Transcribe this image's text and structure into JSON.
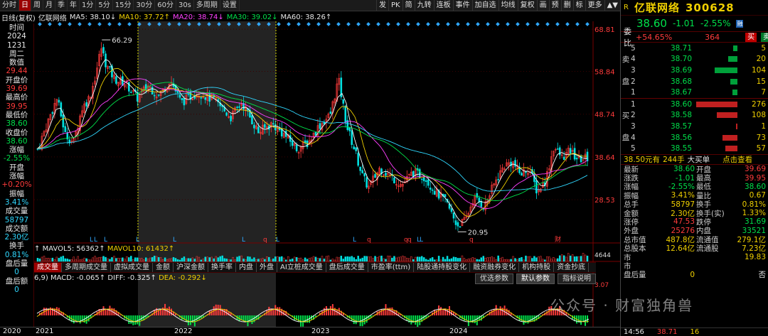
{
  "toolbar": {
    "items": [
      "分时",
      "日",
      "周",
      "月",
      "季",
      "年",
      "1分",
      "5分",
      "15分",
      "30分",
      "60分",
      "30s",
      "多周期",
      "设置"
    ],
    "active_index": 1,
    "right_items": [
      "发",
      "PK",
      "简",
      "九转",
      "连板",
      "事件",
      "加自选",
      "均线",
      "复权",
      "画",
      "预",
      "删",
      "标",
      "更多"
    ],
    "chevrons": "▲▼"
  },
  "infobar": {
    "label": "日线(复权)",
    "stock": "亿联网络",
    "ma5": "MA5: 38.10↓",
    "ma10": "MA10: 37.72↑",
    "ma20": "MA20: 38.74↓",
    "ma30": "MA30: 39.02↓",
    "ma60": "MA60: 38.26↑"
  },
  "leftpanel": {
    "rows": [
      {
        "t": "时间",
        "c": "white"
      },
      {
        "t": "2024",
        "c": "white"
      },
      {
        "t": "1231",
        "c": "white"
      },
      {
        "t": "周二",
        "c": "white"
      },
      {
        "t": "数值",
        "c": "white"
      },
      {
        "t": "29.44",
        "c": "red"
      },
      {
        "t": "开盘价",
        "c": "white"
      },
      {
        "t": "39.69",
        "c": "red"
      },
      {
        "t": "最高价",
        "c": "white"
      },
      {
        "t": "39.95",
        "c": "red"
      },
      {
        "t": "最低价",
        "c": "white"
      },
      {
        "t": "38.60",
        "c": "green"
      },
      {
        "t": "收盘价",
        "c": "white"
      },
      {
        "t": "38.60",
        "c": "green"
      },
      {
        "t": "涨幅",
        "c": "white"
      },
      {
        "t": "-2.55%",
        "c": "green"
      },
      {
        "t": "开盘",
        "c": "white"
      },
      {
        "t": "涨幅",
        "c": "white"
      },
      {
        "t": "+0.20%",
        "c": "red"
      },
      {
        "t": "振幅",
        "c": "white"
      },
      {
        "t": "3.41%",
        "c": "cyan"
      },
      {
        "t": "成交量",
        "c": "white"
      },
      {
        "t": "58797",
        "c": "cyan"
      },
      {
        "t": "成交额",
        "c": "white"
      },
      {
        "t": "2.30亿",
        "c": "cyan"
      },
      {
        "t": "换手",
        "c": "white"
      },
      {
        "t": "0.81%",
        "c": "cyan"
      },
      {
        "t": "盘后量",
        "c": "white"
      },
      {
        "t": "0",
        "c": "cyan"
      },
      {
        "t": "盘后额",
        "c": "white"
      },
      {
        "t": "0",
        "c": "cyan"
      }
    ]
  },
  "chart_data": {
    "type": "candlestick",
    "y_ticks": [
      "68.81",
      "58.84",
      "48.74",
      "38.64",
      "28.53"
    ],
    "y_tick_values": [
      68.81,
      58.84,
      48.74,
      38.64,
      28.53
    ],
    "ylim": [
      20.0,
      70.0
    ],
    "annotations": [
      {
        "label": "66.29",
        "value": 66.29,
        "note": "high"
      },
      {
        "label": "20.95",
        "value": 20.95,
        "note": "low"
      }
    ],
    "x_year_labels": [
      "2020",
      "2021",
      "2022",
      "2023",
      "2024"
    ],
    "close_path": [
      [
        0.0,
        40.5
      ],
      [
        0.02,
        47.5
      ],
      [
        0.035,
        52.5
      ],
      [
        0.05,
        44.0
      ],
      [
        0.065,
        42.0
      ],
      [
        0.08,
        50.0
      ],
      [
        0.095,
        53.0
      ],
      [
        0.105,
        58.0
      ],
      [
        0.115,
        64.5
      ],
      [
        0.125,
        60.0
      ],
      [
        0.14,
        57.0
      ],
      [
        0.16,
        56.0
      ],
      [
        0.18,
        52.5
      ],
      [
        0.2,
        55.5
      ],
      [
        0.22,
        53.0
      ],
      [
        0.24,
        57.0
      ],
      [
        0.26,
        51.5
      ],
      [
        0.29,
        54.0
      ],
      [
        0.32,
        52.0
      ],
      [
        0.35,
        48.0
      ],
      [
        0.37,
        51.5
      ],
      [
        0.4,
        44.5
      ],
      [
        0.425,
        46.5
      ],
      [
        0.45,
        43.5
      ],
      [
        0.47,
        40.5
      ],
      [
        0.49,
        42.0
      ],
      [
        0.51,
        46.0
      ],
      [
        0.53,
        48.5
      ],
      [
        0.545,
        57.0
      ],
      [
        0.56,
        46.0
      ],
      [
        0.575,
        40.0
      ],
      [
        0.59,
        33.5
      ],
      [
        0.6,
        31.5
      ],
      [
        0.62,
        36.0
      ],
      [
        0.64,
        34.0
      ],
      [
        0.66,
        32.0
      ],
      [
        0.68,
        35.0
      ],
      [
        0.7,
        34.0
      ],
      [
        0.72,
        30.5
      ],
      [
        0.74,
        28.0
      ],
      [
        0.76,
        22.5
      ],
      [
        0.775,
        23.5
      ],
      [
        0.79,
        29.0
      ],
      [
        0.81,
        27.0
      ],
      [
        0.83,
        33.0
      ],
      [
        0.845,
        36.5
      ],
      [
        0.86,
        37.5
      ],
      [
        0.875,
        34.5
      ],
      [
        0.89,
        36.0
      ],
      [
        0.905,
        30.5
      ],
      [
        0.92,
        33.0
      ],
      [
        0.935,
        41.0
      ],
      [
        0.95,
        38.5
      ],
      [
        0.965,
        40.0
      ],
      [
        0.98,
        38.0
      ],
      [
        1.0,
        38.6
      ]
    ],
    "event_markers": [
      "L",
      "L",
      "L",
      "L",
      "L",
      "L",
      "q",
      "L",
      "L",
      "q",
      "L",
      "L",
      "q",
      "q",
      "q",
      "财"
    ]
  },
  "volinfo": {
    "prefix": "↑",
    "mavol5": "MAVOL5: 56362↑",
    "mavol10": "MAVOL10: 61432↑",
    "axis_label": "4644"
  },
  "indtabs": {
    "items": [
      "成交量",
      "多周期成交量",
      "虚拟成交量",
      "金额",
      "沪深金额",
      "换手率",
      "内盘",
      "外盘",
      "AI立桩成交量",
      "盘后成交量",
      "市盈率(ttm)",
      "陆股通持股变化",
      "融资融券变化",
      "机构持股",
      "资金抄底"
    ],
    "active_index": 0
  },
  "macd": {
    "params": "6,9)",
    "macd": "MACD: -0.065↑",
    "diff": "DIFF: -0.325↑",
    "dea": "DEA: -0.292↓",
    "axis_label": "3.07",
    "buttons": [
      "优选参数",
      "默认参数",
      "指标说明"
    ],
    "selected_button": 1
  },
  "right": {
    "logo": "R",
    "name": "亿联网络",
    "code": "300628",
    "price": "38.60",
    "change": "-1.01",
    "pct": "-2.55%",
    "tag": "融",
    "weibi_label": "委比",
    "weibi_val": "+54.65%",
    "weibi_qty": "364",
    "buy_btn": "买",
    "sell_btn": "卖",
    "asks": [
      {
        "lvl": "5",
        "px": "38.71",
        "qty": "5",
        "bar": 0.1
      },
      {
        "lvl": "4",
        "px": "38.70",
        "qty": "20",
        "bar": 0.22
      },
      {
        "lvl": "3",
        "px": "38.69",
        "qty": "104",
        "bar": 0.55
      },
      {
        "lvl": "2",
        "px": "38.68",
        "qty": "15",
        "bar": 0.18
      },
      {
        "lvl": "1",
        "px": "38.67",
        "qty": "7",
        "bar": 0.12
      }
    ],
    "ask_side_chars": [
      "卖",
      "盘"
    ],
    "bids": [
      {
        "lvl": "1",
        "px": "38.60",
        "qty": "276",
        "bar": 1.0
      },
      {
        "lvl": "2",
        "px": "38.58",
        "qty": "108",
        "bar": 0.5
      },
      {
        "lvl": "3",
        "px": "38.57",
        "qty": "1",
        "bar": 0.04
      },
      {
        "lvl": "4",
        "px": "38.56",
        "qty": "73",
        "bar": 0.36
      },
      {
        "lvl": "5",
        "px": "38.55",
        "qty": "57",
        "bar": 0.3
      }
    ],
    "bid_side_chars": [
      "买",
      "盘"
    ],
    "bigorder": {
      "a": "38.50元有",
      "b": "244手",
      "c": "大买单",
      "link": "点击查看"
    },
    "stats": [
      {
        "l": "最新",
        "v": "38.60",
        "vc": "green",
        "l2": "开盘",
        "v2": "39.69",
        "v2c": "red"
      },
      {
        "l": "涨跌",
        "v": "-1.01",
        "vc": "green",
        "l2": "最高",
        "v2": "39.95",
        "v2c": "red"
      },
      {
        "l": "涨幅",
        "v": "-2.55%",
        "vc": "green",
        "l2": "最低",
        "v2": "38.60",
        "v2c": "green"
      },
      {
        "l": "振幅",
        "v": "3.41%",
        "vc": "yellow",
        "l2": "量比",
        "v2": "0.67",
        "v2c": "yellow"
      },
      {
        "l": "总手",
        "v": "58797",
        "vc": "yellow",
        "l2": "换手",
        "v2": "0.81%",
        "v2c": "yellow"
      },
      {
        "l": "金额",
        "v": "2.30亿",
        "vc": "yellow",
        "l2": "换手(实)",
        "v2": "1.33%",
        "v2c": "yellow"
      },
      {
        "l": "涨停",
        "v": "47.53",
        "vc": "red",
        "l2": "跌停",
        "v2": "31.69",
        "v2c": "green"
      },
      {
        "l": "外盘",
        "v": "25276",
        "vc": "red",
        "l2": "内盘",
        "v2": "33521",
        "v2c": "green"
      },
      {
        "l": "总市值",
        "v": "487.8亿",
        "vc": "yellow",
        "l2": "流通值",
        "v2": "279.1亿",
        "v2c": "yellow"
      },
      {
        "l": "总股本",
        "v": "12.64亿",
        "vc": "yellow",
        "l2": "流通股",
        "v2": "7.23亿",
        "v2c": "yellow"
      },
      {
        "l": "市",
        "v": "",
        "vc": "yellow",
        "l2": "",
        "v2": "19.83",
        "v2c": "yellow"
      },
      {
        "l": "市",
        "v": "",
        "vc": "yellow",
        "l2": "",
        "v2": "",
        "v2c": "yellow"
      },
      {
        "l": "盘后量",
        "v": "0",
        "vc": "yellow",
        "l2": "",
        "v2": "否",
        "v2c": "white"
      }
    ],
    "foot": [
      "14:56",
      "38.71",
      "16"
    ]
  },
  "watermark": "公众号 · 财富独角兽"
}
